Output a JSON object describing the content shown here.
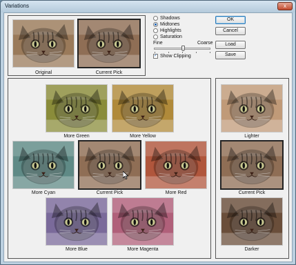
{
  "window": {
    "title": "Variations",
    "close_glyph": "x"
  },
  "preview": {
    "original_label": "Original",
    "current_pick_label": "Current Pick"
  },
  "tones": {
    "options": [
      "Shadows",
      "Midtones",
      "Highlights",
      "Saturation"
    ],
    "selected": "Midtones"
  },
  "slider": {
    "fine_label": "Fine",
    "coarse_label": "Coarse",
    "position": 0.55
  },
  "show_clipping": {
    "label": "Show Clipping",
    "checked": true,
    "check_glyph": "✓"
  },
  "buttons": {
    "ok": "OK",
    "cancel": "Cancel",
    "load": "Load",
    "save": "Save"
  },
  "color_variations": {
    "more_green": "More Green",
    "more_yellow": "More Yellow",
    "more_cyan": "More Cyan",
    "current_pick": "Current Pick",
    "more_red": "More Red",
    "more_blue": "More Blue",
    "more_magenta": "More Magenta"
  },
  "lightness": {
    "lighter": "Lighter",
    "current_pick": "Current Pick",
    "darker": "Darker"
  },
  "tints": {
    "original": "#9a7a5a",
    "current_pick": "#8f6e55",
    "more_green": "#8a8c3a",
    "more_yellow": "#b08a3a",
    "more_cyan": "#5f8a86",
    "more_red": "#b0563c",
    "more_blue": "#7a6a9a",
    "more_magenta": "#b0607a",
    "lighter": "#c09a78",
    "darker": "#6a4e3a"
  }
}
